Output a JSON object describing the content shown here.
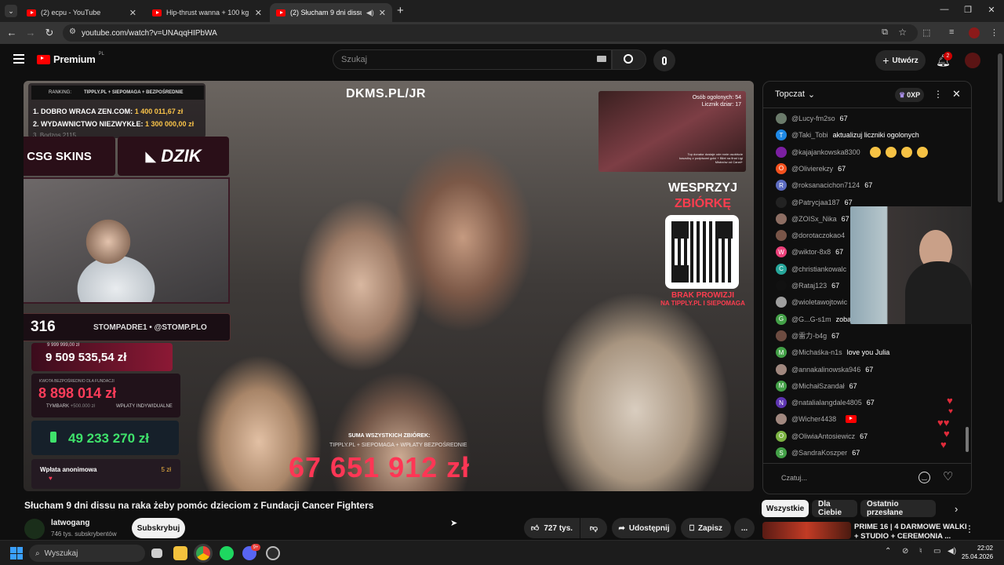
{
  "browser": {
    "tabs": [
      {
        "title": "(2) ecpu - YouTube",
        "active": false
      },
      {
        "title": "Hip-thrust wanna + 100 kg - Yo",
        "active": false
      },
      {
        "title": "(2) Słucham 9 dni dissu na",
        "active": true
      }
    ],
    "new_tab": "+",
    "url": "youtube.com/watch?v=UNAqqHIPbWA"
  },
  "yt_header": {
    "logo": "Premium",
    "logo_region": "PL",
    "search_placeholder": "Szukaj",
    "create_label": "Utwórz",
    "notif_count": "2"
  },
  "video_overlay": {
    "ranking_label": "RANKING:",
    "ranking_sources": "TIPPLY.PL + SIEPOMAGA + BEZPOŚREDNIE",
    "rank1": "1. DOBRO WRACA ZEN.COM:",
    "rank1_val": "1 400 011,67 zł",
    "rank2": "2. WYDAWNICTWO NIEZWYKŁE:",
    "rank2_val": "1 300 000,00 zł",
    "rank3": "3. Bodzos 2115",
    "dkms": "DKMS.PL/JR",
    "csgo": "CSG SKINS",
    "dzik": "DZIK",
    "counter": "316",
    "social": "STOMPADRE1 • @STOMP.PLO",
    "goal_small": "9 999 999,00 zł",
    "amount1": "9 509 535,54 zł",
    "fund_label": "KWOTA BEZPOŚREDNIO DLA FUNDACJI",
    "amount2": "8 898 014 zł",
    "tymbark": "TYMBARK",
    "tymbark_val": "+500.000 zł",
    "indiv": "WPŁATY INDYWIDUALNE",
    "amount3": "49 233 270 zł",
    "anon": "Wpłata anonimowa",
    "anon_val": "5 zł",
    "persons": "Osób ogolonych: 54",
    "licznik": "Licznik dziar: 17",
    "top_donator": "Top donator dostaje ode mnie osobiście koszulkę z podpisami golci + Bilet na finał Ligi Mistrzów od Canal+",
    "wesprzyj": "WESPRZYJ",
    "zbiorke": "ZBIÓRKĘ",
    "brak": "BRAK PROWIZJI",
    "tipply": "NA TIPPLY.PL I SIEPOMAGA",
    "suma_label": "SUMA WSZYSTKICH ZBIÓREK:",
    "suma_sources": "TIPPLY.PL + SIEPOMAGA + WPŁATY BEZPOŚREDNIE",
    "total": "67 651 912 zł"
  },
  "chat": {
    "title": "Topczat",
    "xp": "0XP",
    "input_placeholder": "Czatuj...",
    "messages": [
      {
        "author": "@Lucy-fm2so",
        "text": "67",
        "color": "#6b7b6b",
        "letter": ""
      },
      {
        "author": "@Taki_Tobi",
        "text": "aktualizuj liczniki ogolonych",
        "color": "#1e88e5",
        "letter": "T"
      },
      {
        "author": "@kajajankowska8300",
        "text": "",
        "color": "#7b1fa2",
        "letter": "",
        "emoji": 4
      },
      {
        "author": "@Olivierekzy",
        "text": "67",
        "color": "#f4511e",
        "letter": "O"
      },
      {
        "author": "@roksanacichon7124",
        "text": "67",
        "color": "#5c6bc0",
        "letter": "R"
      },
      {
        "author": "@Patrycjaa187",
        "text": "67",
        "color": "#222222",
        "letter": ""
      },
      {
        "author": "@ZOISx_Nika",
        "text": "67",
        "color": "#8d6e63",
        "letter": ""
      },
      {
        "author": "@dorotaczokao4",
        "text": "",
        "color": "#795548",
        "letter": ""
      },
      {
        "author": "@wiktor-8x8",
        "text": "67",
        "color": "#ec407a",
        "letter": "W"
      },
      {
        "author": "@christiankowalc",
        "text": "",
        "color": "#26a69a",
        "letter": "C"
      },
      {
        "author": "@Rataj123",
        "text": "67",
        "color": "#111111",
        "letter": ""
      },
      {
        "author": "@wioletawojtowic",
        "text": "",
        "color": "#9e9e9e",
        "letter": ""
      },
      {
        "author": "@G...G-s1m",
        "text": "zoba",
        "color": "#43a047",
        "letter": "G"
      },
      {
        "author": "@雷力-b4g",
        "text": "67",
        "color": "#6d4c41",
        "letter": ""
      },
      {
        "author": "@Michaśka-n1s",
        "text": "love you Julia",
        "color": "#43a047",
        "letter": "M"
      },
      {
        "author": "@annakalinowska946",
        "text": "67",
        "color": "#a1887f",
        "letter": ""
      },
      {
        "author": "@MichałSzandał",
        "text": "67",
        "color": "#43a047",
        "letter": "M"
      },
      {
        "author": "@natalialangdale4805",
        "text": "67",
        "color": "#5e35b1",
        "letter": "N"
      },
      {
        "author": "@Wicher4438",
        "text": "",
        "color": "#a1887f",
        "letter": "",
        "yt": true
      },
      {
        "author": "@OliwiaAntosiewicz",
        "text": "67",
        "color": "#7cb342",
        "letter": "O"
      },
      {
        "author": "@SandraKoszper",
        "text": "67",
        "color": "#43a047",
        "letter": "S"
      }
    ]
  },
  "video_info": {
    "title": "Słucham 9 dni dissu na raka żeby pomóc dzieciom z Fundacji Cancer Fighters",
    "channel": "latwogang",
    "subs": "746 tys. subskrybentów",
    "subscribe": "Subskrybuj",
    "likes": "727 tys.",
    "share": "Udostępnij",
    "save": "Zapisz",
    "more": "..."
  },
  "chips": [
    "Wszystkie",
    "Dla Ciebie",
    "Ostatnio przesłane"
  ],
  "next_video": {
    "title1": "PRIME 16 | 4 DARMOWE WALKI",
    "title2": "+ STUDIO + CEREMONIA ..."
  },
  "taskbar": {
    "search": "Wyszukaj",
    "time": "22:02",
    "date": "25.04.2026",
    "badge": "9+"
  }
}
